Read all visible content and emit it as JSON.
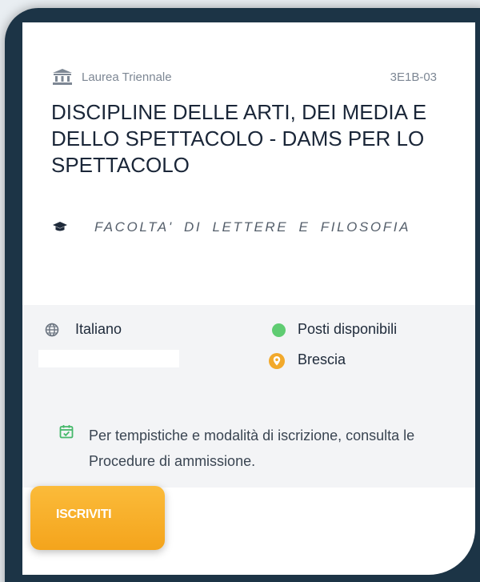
{
  "card": {
    "degree_type": "Laurea Triennale",
    "code": "3E1B-03",
    "title": "DISCIPLINE DELLE ARTI, DEI MEDIA E DELLO SPETTACOLO - DAMS PER LO SPETTACOLO",
    "faculty": "FACOLTA' DI LETTERE E FILOSOFIA",
    "language": "Italiano",
    "availability": "Posti disponibili",
    "city": "Brescia",
    "admission_note": "Per tempistiche e modalità di iscrizione, consulta le Procedure di ammissione.",
    "enroll_button": "ISCRIVITI"
  },
  "icons": {
    "degree": "institution-icon",
    "faculty": "graduation-cap-icon",
    "language": "globe-icon",
    "availability": "green-dot-icon",
    "city": "map-pin-icon",
    "note": "calendar-check-icon"
  },
  "colors": {
    "frame": "#1c3446",
    "availability_dot": "#5fcc72",
    "pin": "#f2a92b",
    "note_icon": "#45b86a",
    "button": "#f7ac26"
  }
}
